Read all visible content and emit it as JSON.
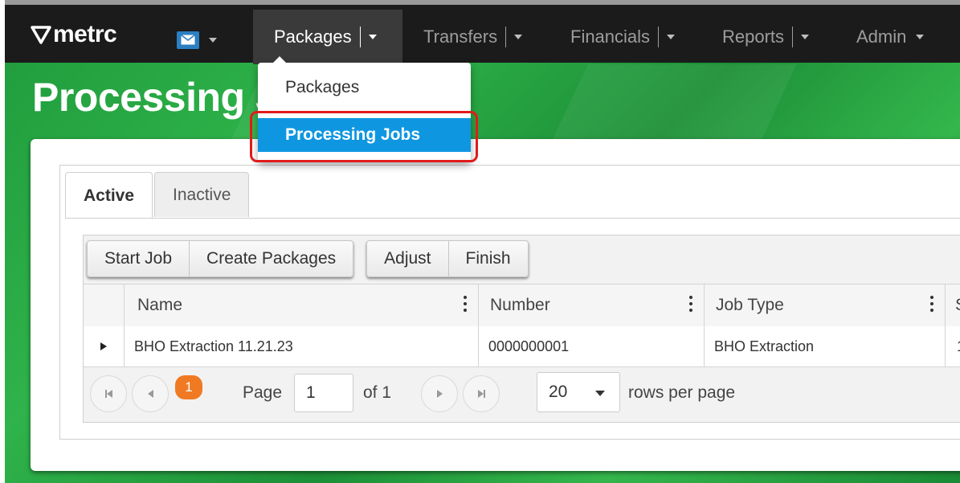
{
  "nav": {
    "logo": "metrc",
    "items": [
      {
        "label": "Packages"
      },
      {
        "label": "Transfers"
      },
      {
        "label": "Financials"
      },
      {
        "label": "Reports"
      },
      {
        "label": "Admin"
      }
    ],
    "mail_icon": "envelope-icon"
  },
  "dropdown": {
    "items": [
      {
        "label": "Packages"
      },
      {
        "label": "Processing Jobs"
      }
    ]
  },
  "page": {
    "title": "Processing Jobs"
  },
  "tabs": [
    {
      "label": "Active"
    },
    {
      "label": "Inactive"
    }
  ],
  "toolbar": {
    "start_job": "Start Job",
    "create_packages": "Create Packages",
    "adjust": "Adjust",
    "finish": "Finish"
  },
  "table": {
    "headers": {
      "name": "Name",
      "number": "Number",
      "job_type": "Job Type",
      "next": "S"
    },
    "rows": [
      {
        "name": "BHO Extraction 11.21.23",
        "number": "0000000001",
        "job_type": "BHO Extraction",
        "next": "1"
      }
    ]
  },
  "pager": {
    "current_page_badge": "1",
    "page_label": "Page",
    "page_input_value": "1",
    "of_label": "of 1",
    "rows_per_page_value": "20",
    "rows_per_page_label": "rows per page"
  },
  "colors": {
    "navbar": "#1b1b1b",
    "accent_blue": "#0f96e0",
    "page_badge": "#f07a23",
    "highlight_red": "#e01b1b",
    "background_green": "#2fb34a"
  }
}
